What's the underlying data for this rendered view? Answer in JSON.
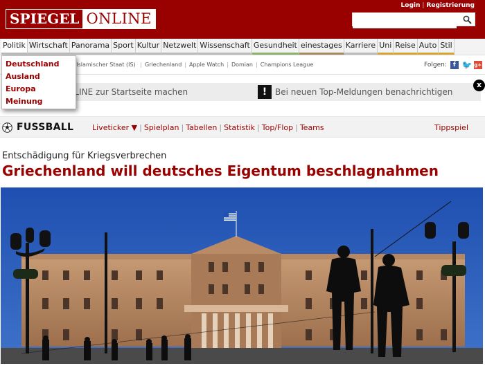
{
  "header": {
    "logo_left": "SPIEGEL",
    "logo_right": "ONLINE",
    "login": "Login",
    "register": "Registrierung",
    "search_placeholder": "",
    "search_icon": "search-icon"
  },
  "nav": {
    "items": [
      "Politik",
      "Wirtschaft",
      "Panorama",
      "Sport",
      "Kultur",
      "Netzwelt",
      "Wissenschaft",
      "Gesundheit",
      "einestages",
      "Karriere",
      "Uni",
      "Reise",
      "Auto",
      "Stil"
    ],
    "underline_colors": [
      "#bbbbbb",
      "#bbbbbb",
      "#bbbbbb",
      "#bbbbbb",
      "#bbbbbb",
      "#bbbbbb",
      "#bbbbbb",
      "#8cb36c",
      "#a58b5f",
      "#bbbbbb",
      "#d9a431",
      "#d9a431",
      "#d9a431",
      "#d9a431"
    ]
  },
  "dropdown": {
    "items": [
      "Deutschland",
      "Ausland",
      "Europa",
      "Meinung"
    ]
  },
  "topics": {
    "visible_tail": ": Islamischer Staat (IS)",
    "items": [
      "Griechenland",
      "Apple Watch",
      "Domian",
      "Champions League"
    ],
    "follow_label": "Folgen:"
  },
  "infobar": {
    "left_text": "EGEL ONLINE zur Startseite machen",
    "right_text": "Bei neuen Top-Meldungen benachrichtigen",
    "alert_icon": "!",
    "close_icon": "x"
  },
  "fussball": {
    "title": "FUSSBALL",
    "links": [
      "Liveticker ▼",
      "Spielplan",
      "Tabellen",
      "Statistik",
      "Top/Flop",
      "Teams"
    ],
    "tipp": "Tippspiel"
  },
  "article": {
    "kicker": "Entschädigung für Kriegsverbrechen",
    "headline": "Griechenland will deutsches Eigentum beschlagnahmen"
  },
  "colors": {
    "brand_red": "#990000",
    "sky": "#2a59b5"
  }
}
